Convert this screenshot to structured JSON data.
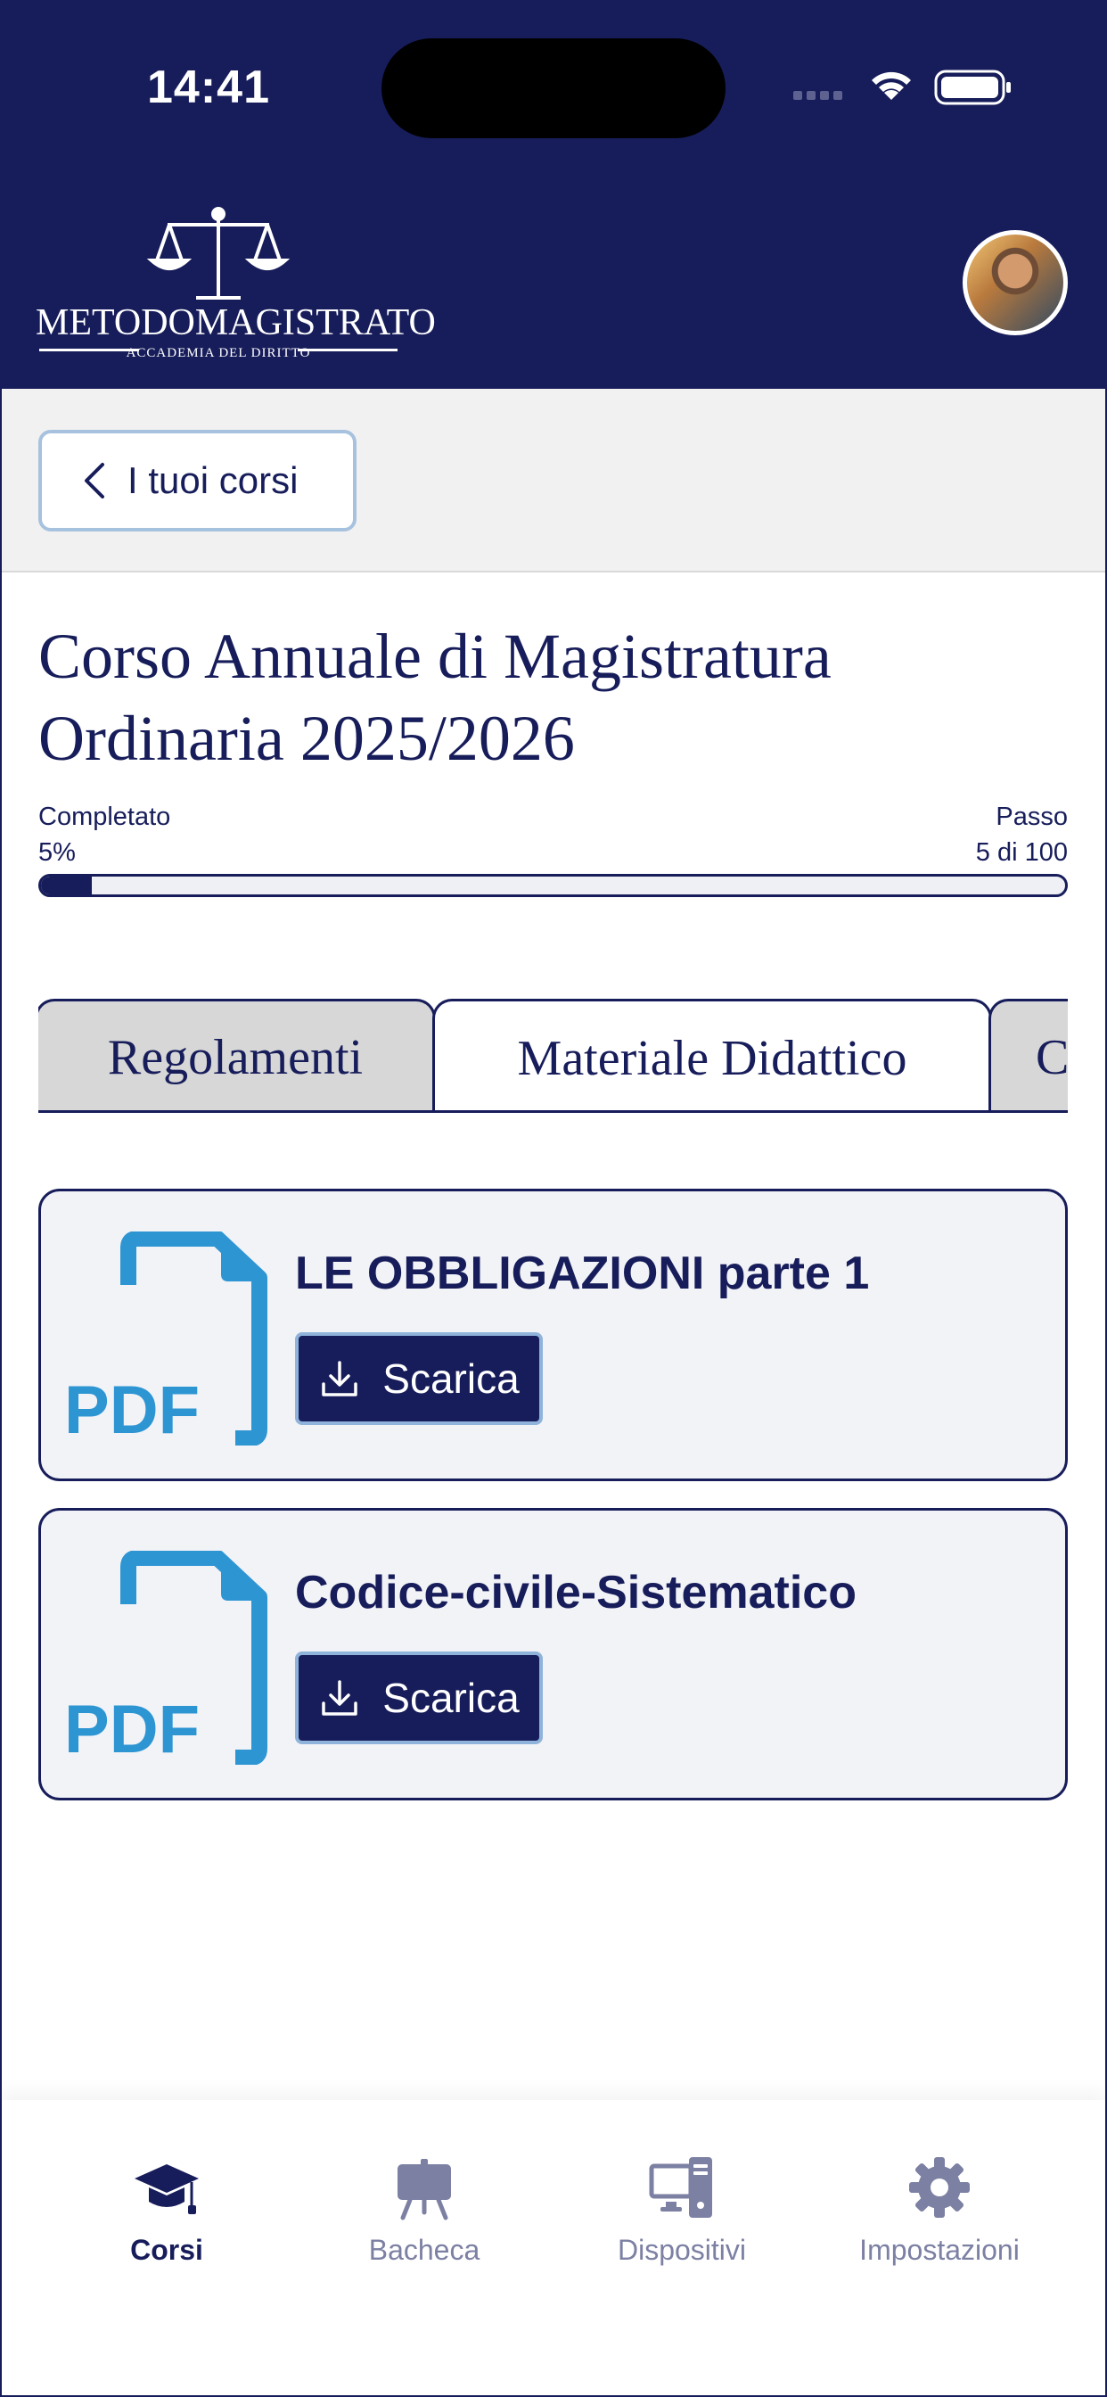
{
  "status_bar": {
    "time": "14:41"
  },
  "header": {
    "logo_text": "METODOMAGISTRATO",
    "logo_subtitle": "ACCADEMIA DEL DIRITTO"
  },
  "back": {
    "label": "I tuoi corsi"
  },
  "course": {
    "title": "Corso Annuale di Magistratura Ordinaria 2025/2026",
    "completed_label": "Completato",
    "completed_value": "5%",
    "progress_fraction": 0.05,
    "step_label": "Passo",
    "step_value": "5 di 100"
  },
  "tabs": [
    {
      "label": "Regolamenti"
    },
    {
      "label": "Materiale Didattico",
      "active": true
    },
    {
      "label": "C"
    }
  ],
  "materials": [
    {
      "title": "LE OBBLIGAZIONI parte 1",
      "button": "Scarica",
      "icon": "pdf-file-icon",
      "icon_text": "PDF"
    },
    {
      "title": "Codice-civile-Sistematico",
      "button": "Scarica",
      "icon": "pdf-file-icon",
      "icon_text": "PDF"
    }
  ],
  "bottom_nav": [
    {
      "label": "Corsi",
      "icon": "graduation-cap-icon",
      "active": true
    },
    {
      "label": "Bacheca",
      "icon": "presentation-board-icon"
    },
    {
      "label": "Dispositivi",
      "icon": "devices-icon"
    },
    {
      "label": "Impostazioni",
      "icon": "gear-icon"
    }
  ],
  "colors": {
    "primary": "#171d5a",
    "pdf_blue": "#2e95d3",
    "nav_inactive": "#7c80a3"
  }
}
